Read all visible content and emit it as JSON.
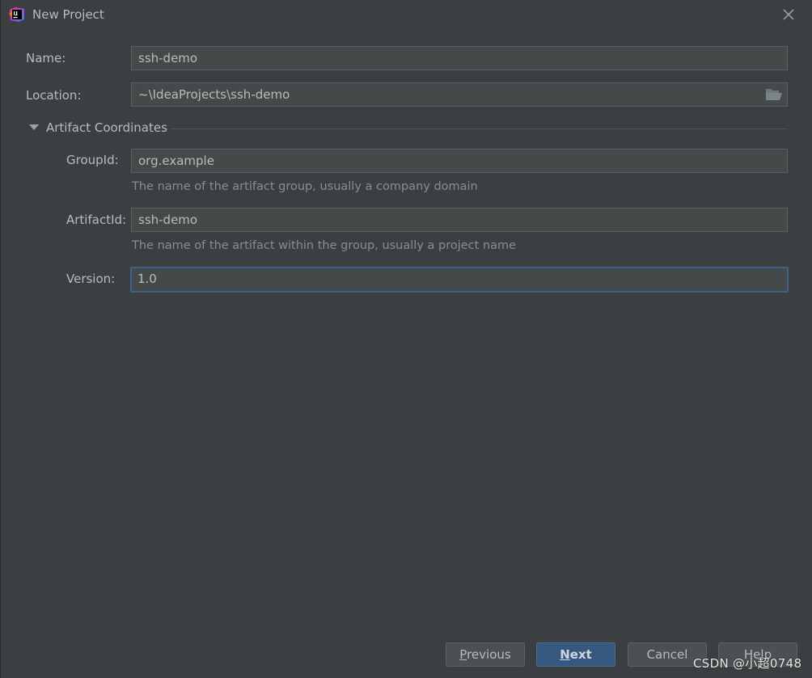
{
  "window": {
    "title": "New Project",
    "app_icon": "intellij-idea-icon",
    "close_icon": "close-icon"
  },
  "form": {
    "name": {
      "label": "Name:",
      "value": "ssh-demo"
    },
    "location": {
      "label": "Location:",
      "value": "~\\IdeaProjects\\ssh-demo",
      "browse_icon": "folder-open-icon"
    },
    "section": {
      "label": "Artifact Coordinates",
      "expanded": true
    },
    "group_id": {
      "label": "GroupId:",
      "value": "org.example",
      "hint": "The name of the artifact group, usually a company domain"
    },
    "artifact_id": {
      "label": "ArtifactId:",
      "value": "ssh-demo",
      "hint": "The name of the artifact within the group, usually a project name"
    },
    "version": {
      "label": "Version:",
      "value": "1.0",
      "focused": true
    }
  },
  "buttons": {
    "previous": {
      "mnemonic": "P",
      "rest": "revious"
    },
    "next": {
      "mnemonic": "N",
      "rest": "ext"
    },
    "cancel": {
      "label": "Cancel"
    },
    "help": {
      "label": "Help"
    }
  },
  "colors": {
    "background": "#3c3f41",
    "field_background": "#45494a",
    "primary_button": "#365880",
    "focus_border": "#3d6185"
  },
  "watermark": "CSDN @小超0748"
}
